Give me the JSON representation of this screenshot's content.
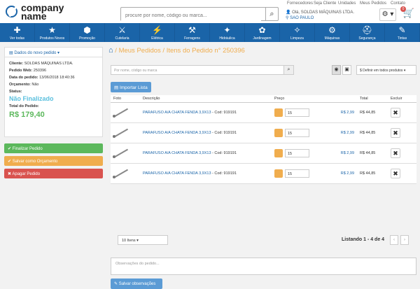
{
  "logo": {
    "line1": "company",
    "line2": "name"
  },
  "search": {
    "placeholder": "procure por nome, código ou marca...",
    "icon": "search-icon"
  },
  "toplinks": [
    "Fornecedores",
    "Seja Cliente",
    "Unidades",
    "Meus Pedidos",
    "Contato"
  ],
  "user": {
    "greeting": "Olá, SOLDAS MÁQUINAS LTDA.",
    "location": "SAO PAULO"
  },
  "cart": {
    "count": "0"
  },
  "categories": [
    {
      "label": "Ver todas",
      "icon": "✚"
    },
    {
      "label": "Produtos Novos",
      "icon": "★"
    },
    {
      "label": "Promoção",
      "icon": "⬢"
    },
    {
      "label": "Cutelaria",
      "icon": "⚔"
    },
    {
      "label": "Elétrica",
      "icon": "⚡"
    },
    {
      "label": "Ferragens",
      "icon": "⚒"
    },
    {
      "label": "Hidráulica",
      "icon": "✦"
    },
    {
      "label": "Jardinagem",
      "icon": "✿"
    },
    {
      "label": "Limpeza",
      "icon": "✧"
    },
    {
      "label": "Máquinas",
      "icon": "⚙"
    },
    {
      "label": "Segurança",
      "icon": "⛑"
    },
    {
      "label": "Tintas",
      "icon": "✎"
    }
  ],
  "sidebar": {
    "header": "Dados do novo pedido",
    "cliente_label": "Cliente:",
    "cliente": "SOLDAS MÁQUINAS LTDA.",
    "web_label": "Pedido Web:",
    "web": "250396",
    "data_label": "Data do pedido:",
    "data": "13/06/2018 18:40:36",
    "orc_label": "Orçamento:",
    "orc": "Não",
    "status_label": "Status:",
    "status": "Não Finalizado",
    "total_label": "Total do Pedido:",
    "total": "R$ 179,40",
    "finalizar": "Finalizar Pedido",
    "salvar": "Salvar como Orçamento",
    "apagar": "Apagar Pedido"
  },
  "breadcrumb": {
    "sep": "/",
    "meus": "Meus Pedidos",
    "itens": "Itens do Pedido n° 250396"
  },
  "filter": {
    "placeholder": "Por nome, código ou marca",
    "definir": "Definir em todos produtos"
  },
  "importar": "Importar Lista",
  "table": {
    "headers": [
      "Foto",
      "Descrição",
      "Preço",
      "Total",
      "Excluir"
    ],
    "rows": [
      {
        "desc": "PARAFUSO A/A CHATA FENDA 3,9X13",
        "cod": " - Cod: 919191",
        "qty": "15",
        "price": "R$ 2,99",
        "total": "R$ 44,85"
      },
      {
        "desc": "PARAFUSO A/A CHATA FENDA 3,9X13",
        "cod": " - Cod: 919191",
        "qty": "15",
        "price": "R$ 2,99",
        "total": "R$ 44,85"
      },
      {
        "desc": "PARAFUSO A/A CHATA FENDA 3,9X13",
        "cod": " - Cod: 919191",
        "qty": "15",
        "price": "R$ 2,99",
        "total": "R$ 44,85"
      },
      {
        "desc": "PARAFUSO A/A CHATA FENDA 3,9X13",
        "cod": " - Cod: 919191",
        "qty": "15",
        "price": "R$ 2,99",
        "total": "R$ 44,85"
      }
    ]
  },
  "pagination": {
    "per_page": "10 Itens",
    "text": "Listando 1 - 4 de 4",
    "prev": "‹",
    "next": "›"
  },
  "obs": {
    "placeholder": "Observações do pedido...",
    "save": "Salvar observações"
  }
}
